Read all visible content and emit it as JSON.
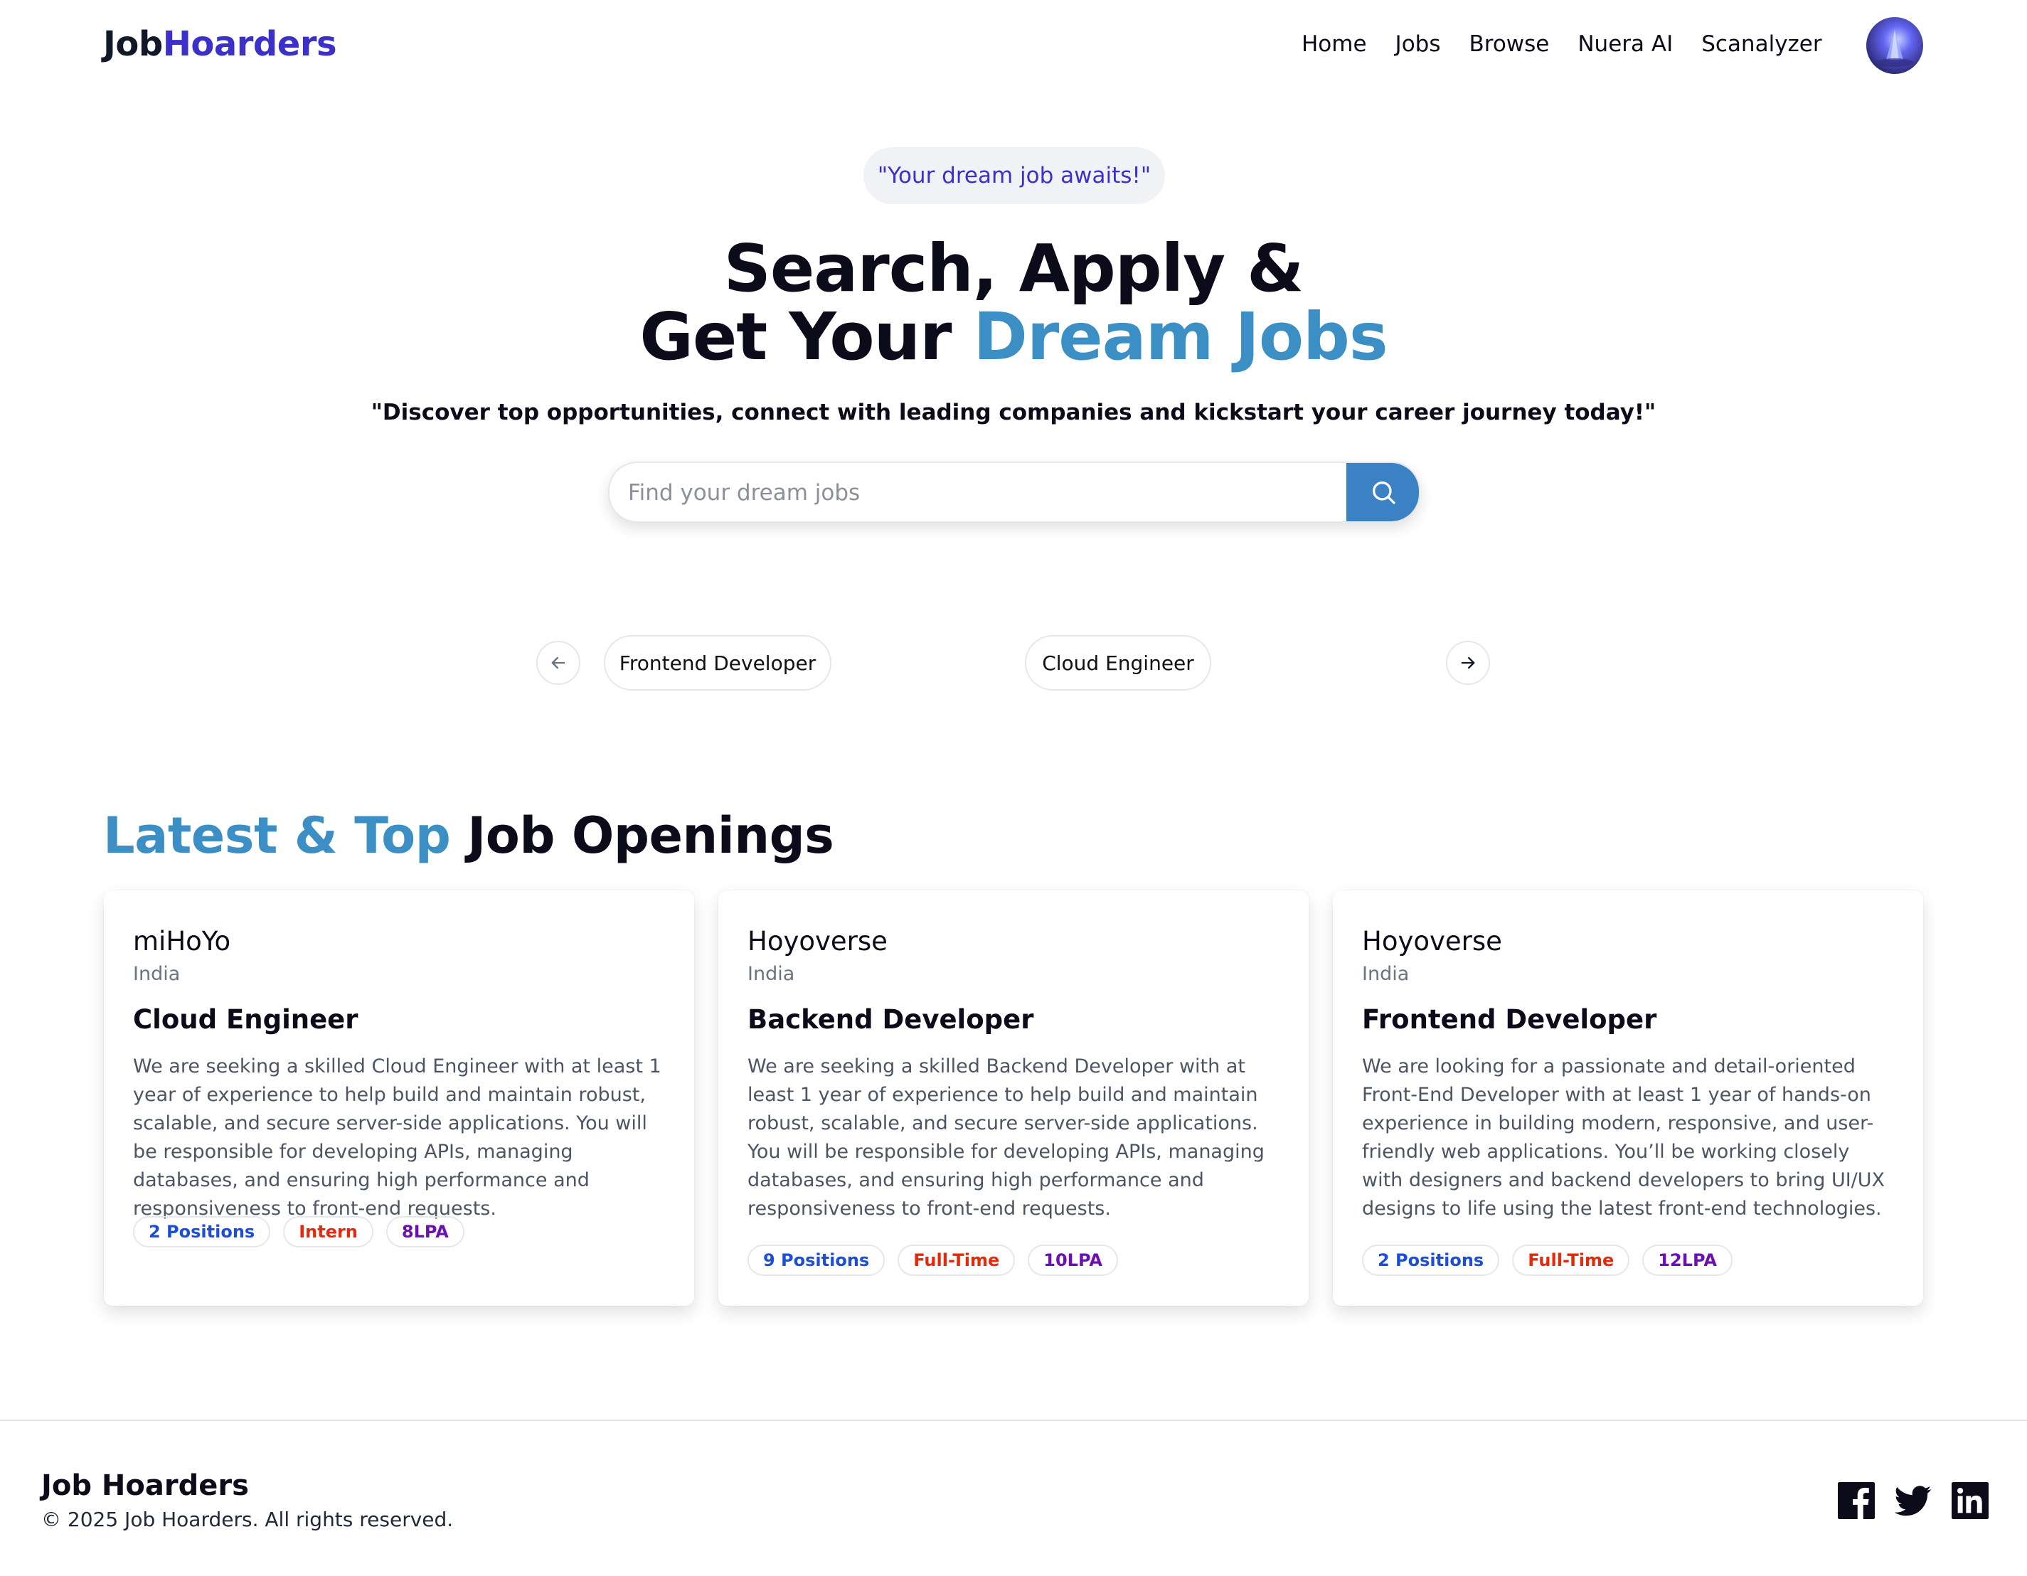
{
  "navbar": {
    "logo_part1": "Job",
    "logo_part2": "Hoarders",
    "links": [
      "Home",
      "Jobs",
      "Browse",
      "Nuera AI",
      "Scanalyzer"
    ],
    "avatar_icon": "profile-avatar"
  },
  "hero": {
    "tagline": "\"Your dream job awaits!\"",
    "title_line1": "Search, Apply &",
    "title_line2_plain": "Get Your ",
    "title_line2_accent": "Dream Jobs",
    "subtitle": "\"Discover top opportunities, connect with leading companies and kickstart your career journey today!\"",
    "search": {
      "placeholder": "Find your dream jobs",
      "value": "",
      "button_icon": "search-icon"
    }
  },
  "carousel": {
    "prev_icon": "arrow-left-icon",
    "next_icon": "arrow-right-icon",
    "chips": [
      "Frontend Developer",
      "Cloud Engineer"
    ]
  },
  "jobs_section": {
    "title_accent": "Latest & Top",
    "title_plain": " Job Openings",
    "cards": [
      {
        "company": "miHoYo",
        "location": "India",
        "title": "Cloud Engineer",
        "description": "We are seeking a skilled Cloud Engineer with at least 1 year of experience to help build and maintain robust, scalable, and secure server-side applications. You will be responsible for developing APIs, managing databases, and ensuring high performance and responsiveness to front-end requests.",
        "positions": "2 Positions",
        "job_type": "Intern",
        "salary": "8LPA"
      },
      {
        "company": "Hoyoverse",
        "location": "India",
        "title": "Backend Developer",
        "description": "We are seeking a skilled Backend Developer with at least 1 year of experience to help build and maintain robust, scalable, and secure server-side applications. You will be responsible for developing APIs, managing databases, and ensuring high performance and responsiveness to front-end requests.",
        "positions": "9 Positions",
        "job_type": "Full-Time",
        "salary": "10LPA"
      },
      {
        "company": "Hoyoverse",
        "location": "India",
        "title": "Frontend Developer",
        "description": "We are looking for a passionate and detail-oriented Front-End Developer with at least 1 year of hands-on experience in building modern, responsive, and user-friendly web applications. You’ll be working closely with designers and backend developers to bring UI/UX designs to life using the latest front-end technologies.",
        "positions": "2 Positions",
        "job_type": "Full-Time",
        "salary": "12LPA"
      }
    ]
  },
  "footer": {
    "brand": "Job Hoarders",
    "copyright": "© 2025 Job Hoarders. All rights reserved.",
    "social_icons": [
      "facebook-icon",
      "twitter-icon",
      "linkedin-icon"
    ]
  },
  "colors": {
    "brand": "#3b31c9",
    "accent": "#3b8fc4",
    "search_button": "#3b82c4",
    "positions_badge": "#1d4ed8",
    "type_badge": "#e5290b",
    "salary_badge": "#6b10b5"
  }
}
